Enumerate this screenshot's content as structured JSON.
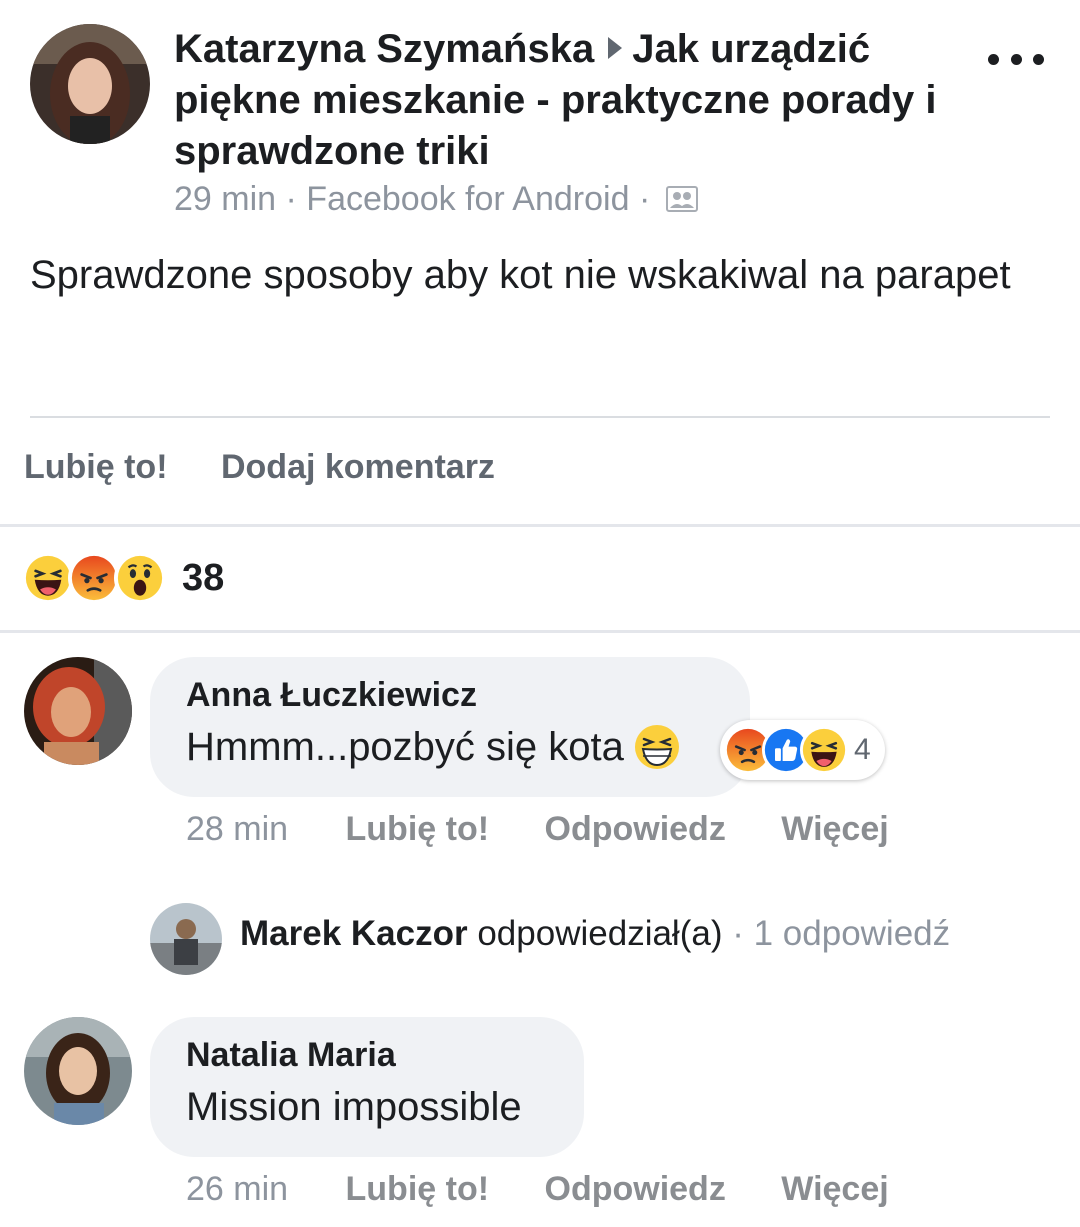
{
  "post": {
    "author": "Katarzyna Szymańska",
    "group": "Jak urządzić piękne mieszkanie - praktyczne porady i sprawdzone triki",
    "time": "29 min",
    "source": "Facebook for Android",
    "audience_icon": "group-audience-icon",
    "text": "Sprawdzone sposoby aby kot nie wskakiwal na parapet"
  },
  "actions": {
    "like_label": "Lubię to!",
    "comment_label": "Dodaj komentarz"
  },
  "reactions": {
    "icons": [
      "haha-emoji",
      "angry-emoji",
      "wow-emoji"
    ],
    "count": "38"
  },
  "comments": [
    {
      "author": "Anna Łuczkiewicz",
      "text": "Hmmm...pozbyć się kota",
      "inline_emoji": "laughing-emoji",
      "reaction_icons": [
        "angry-emoji",
        "like-emoji",
        "haha-emoji"
      ],
      "reaction_count": "4",
      "time": "28 min",
      "like_label": "Lubię to!",
      "reply_label": "Odpowiedz",
      "more_label": "Więcej",
      "reply_preview": {
        "author": "Marek Kaczor",
        "action": "odpowiedział(a)",
        "count": "1 odpowiedź"
      }
    },
    {
      "author": "Natalia Maria",
      "text": "Mission impossible",
      "time": "26 min",
      "like_label": "Lubię to!",
      "reply_label": "Odpowiedz",
      "more_label": "Więcej"
    }
  ],
  "colors": {
    "primary_text": "#1c1e21",
    "secondary_text": "#606770",
    "meta_text": "#8d949e",
    "bubble_bg": "#f0f2f5",
    "like_blue": "#1877f2",
    "angry_orange": "#f0591e",
    "emoji_yellow": "#fbcf3c"
  }
}
